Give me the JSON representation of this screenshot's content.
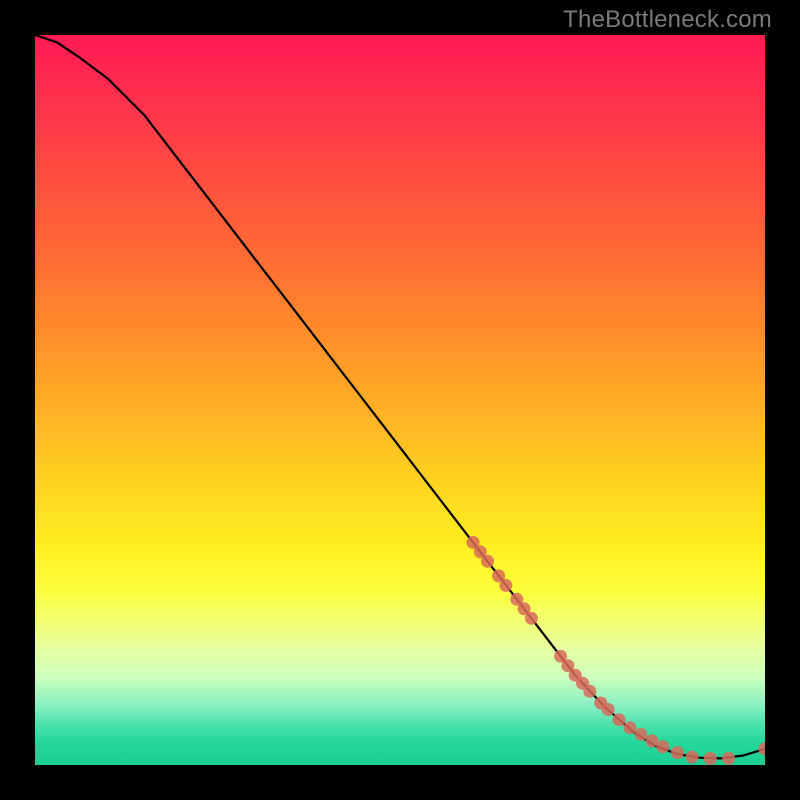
{
  "watermark": "TheBottleneck.com",
  "chart_data": {
    "type": "line",
    "title": "",
    "xlabel": "",
    "ylabel": "",
    "xlim": [
      0,
      100
    ],
    "ylim": [
      0,
      100
    ],
    "curve": {
      "x": [
        0,
        3,
        6,
        10,
        15,
        20,
        25,
        30,
        35,
        40,
        45,
        50,
        55,
        60,
        65,
        70,
        74,
        78,
        82,
        85,
        88,
        91,
        94,
        97,
        100
      ],
      "y": [
        100,
        99,
        97,
        94,
        89,
        82.5,
        76,
        69.5,
        63,
        56.5,
        50,
        43.5,
        37,
        30.5,
        24,
        17.5,
        12.3,
        8,
        4.5,
        2.6,
        1.5,
        1.0,
        0.9,
        1.3,
        2.2
      ]
    },
    "markers": {
      "x": [
        60,
        61,
        62,
        63.5,
        64.5,
        66,
        67,
        68,
        72,
        73,
        74,
        75,
        76,
        77.5,
        78.5,
        80,
        81.5,
        83,
        84.5,
        86,
        88,
        90,
        92.5,
        95,
        100
      ],
      "y": [
        30.5,
        29.2,
        27.9,
        25.9,
        24.6,
        22.7,
        21.4,
        20.1,
        14.9,
        13.6,
        12.3,
        11.2,
        10.1,
        8.5,
        7.6,
        6.2,
        5.1,
        4.2,
        3.3,
        2.5,
        1.7,
        1.1,
        0.9,
        0.9,
        2.2
      ]
    },
    "marker_color": "#d86a5b",
    "curve_color": "#000000"
  }
}
